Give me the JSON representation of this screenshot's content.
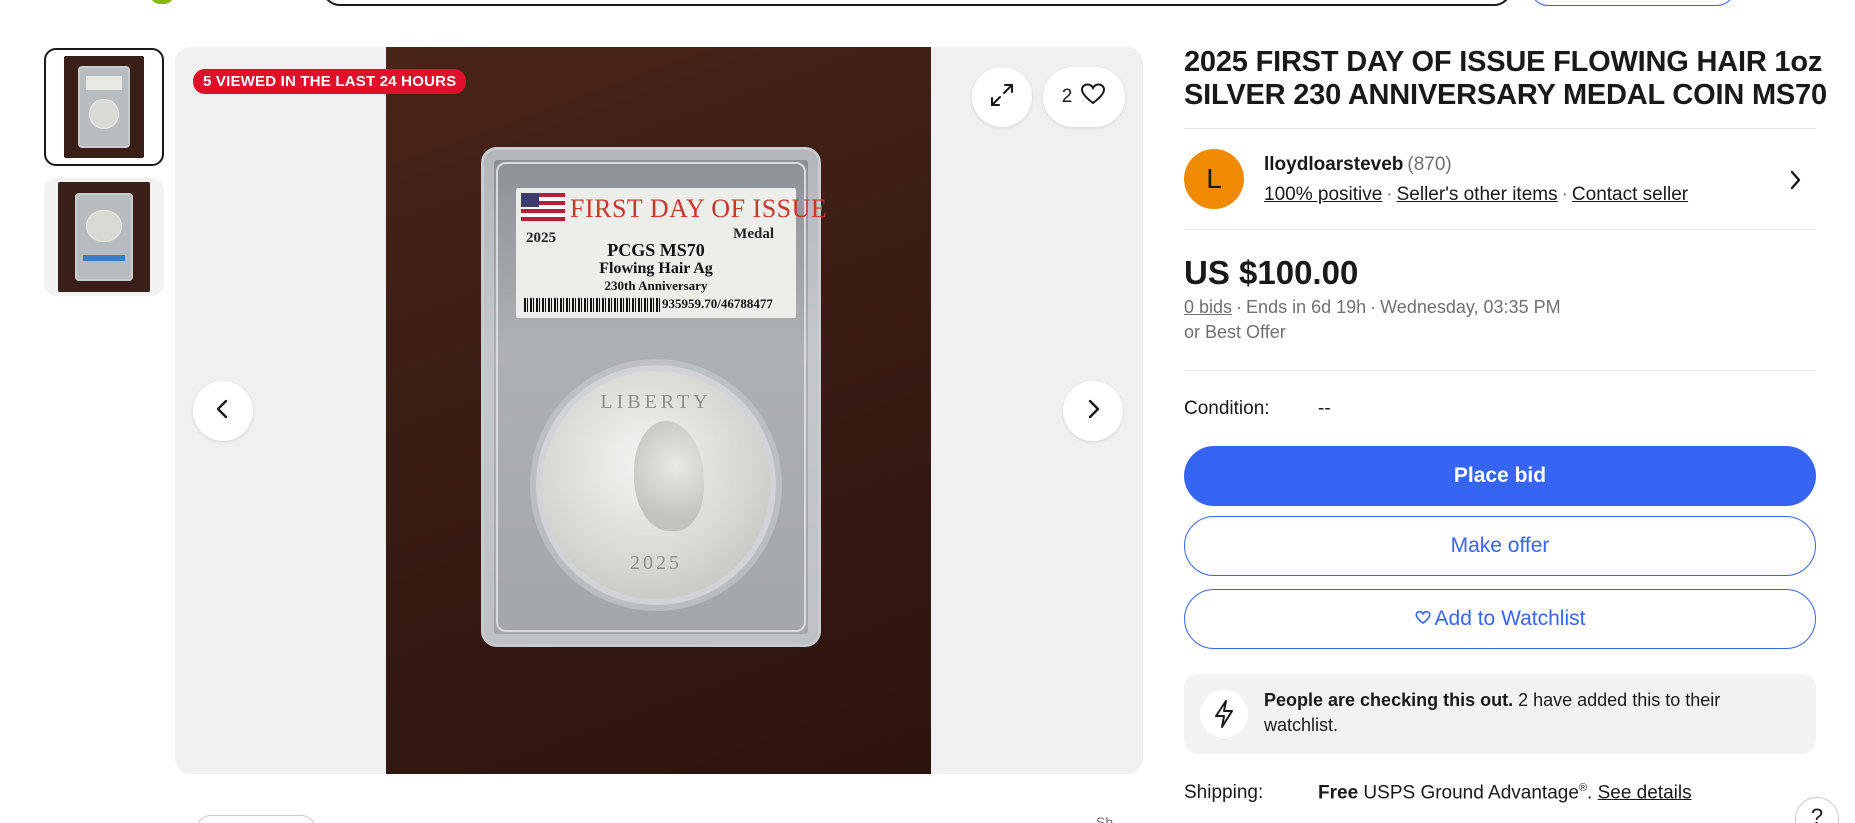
{
  "gallery": {
    "viewed_badge": "5 VIEWED IN THE LAST 24 HOURS",
    "watch_count": "2",
    "label": {
      "title": "FIRST DAY OF ISSUE",
      "year": "2025",
      "type": "Medal",
      "grade": "PCGS MS70",
      "line2": "Flowing Hair Ag",
      "line3": "230th Anniversary",
      "cert": "935959.70/46788477"
    },
    "coin": {
      "legend": "LIBERTY",
      "year": "2025"
    },
    "icons": {
      "expand": "expand-icon",
      "heart": "heart-icon",
      "prev": "chevron-left-icon",
      "next": "chevron-right-icon"
    }
  },
  "listing": {
    "title": "2025 FIRST DAY OF ISSUE FLOWING HAIR 1oz SILVER 230 ANNIVERSARY MEDAL COIN MS70",
    "seller": {
      "avatar_letter": "L",
      "name": "lloydloarsteveb",
      "feedback_count": "(870)",
      "positive": "100% positive",
      "other_items": "Seller's other items",
      "contact": "Contact seller"
    },
    "price": "US $100.00",
    "bids": "0 bids",
    "ends": "Ends in 6d 19h",
    "end_time": "Wednesday, 03:35 PM",
    "best_offer": "or Best Offer",
    "condition_label": "Condition:",
    "condition_value": "--",
    "place_bid": "Place bid",
    "make_offer": "Make offer",
    "add_watchlist": "Add to Watchlist",
    "alert_bold": "People are checking this out.",
    "alert_rest": "2 have added this to their watchlist.",
    "shipping_label": "Shipping:",
    "shipping_free": "Free",
    "shipping_service": "USPS Ground Advantage",
    "shipping_details": "See details"
  },
  "footer": {
    "share_label": "Sh",
    "help": "?"
  },
  "colors": {
    "accent": "#3665f3",
    "badge_red": "#e0102a",
    "avatar_orange": "#f08a00",
    "brand_green": "#86b817"
  }
}
